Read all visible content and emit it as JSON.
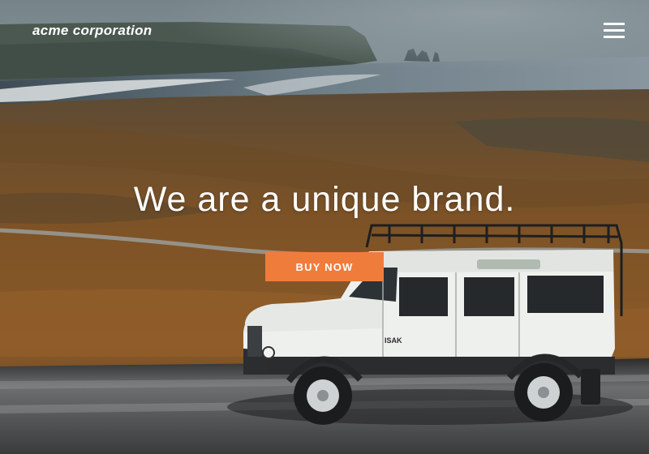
{
  "header": {
    "brand": "acme corporation",
    "menu_icon": "hamburger-menu-icon"
  },
  "hero": {
    "headline": "We are a unique brand.",
    "cta_label": "BUY NOW",
    "background_image": "white off-road vehicle on gravel road, coastal moorland",
    "vehicle_badge": "ISAK"
  },
  "colors": {
    "accent": "#f07c3c",
    "text": "#ffffff"
  }
}
